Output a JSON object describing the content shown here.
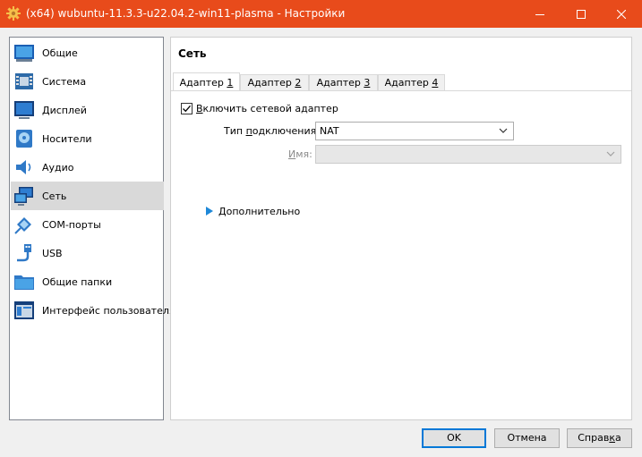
{
  "window": {
    "title": "(x64) wubuntu-11.3.3-u22.04.2-win11-plasma - Настройки",
    "accent": "#e84b1b"
  },
  "sidebar": {
    "items": [
      {
        "label": "Общие",
        "icon": "general-icon"
      },
      {
        "label": "Система",
        "icon": "system-icon"
      },
      {
        "label": "Дисплей",
        "icon": "display-icon"
      },
      {
        "label": "Носители",
        "icon": "storage-icon"
      },
      {
        "label": "Аудио",
        "icon": "audio-icon"
      },
      {
        "label": "Сеть",
        "icon": "network-icon",
        "selected": true
      },
      {
        "label": "COM-порты",
        "icon": "serial-port-icon"
      },
      {
        "label": "USB",
        "icon": "usb-icon"
      },
      {
        "label": "Общие папки",
        "icon": "shared-folder-icon"
      },
      {
        "label": "Интерфейс пользователя",
        "icon": "user-interface-icon"
      }
    ]
  },
  "page": {
    "title": "Сеть",
    "tabs": [
      {
        "prefix": "Адаптер ",
        "num": "1",
        "active": true
      },
      {
        "prefix": "Адаптер ",
        "num": "2"
      },
      {
        "prefix": "Адаптер ",
        "num": "3"
      },
      {
        "prefix": "Адаптер ",
        "num": "4"
      }
    ],
    "enable_checkbox": {
      "label_first": "В",
      "label_rest": "ключить сетевой адаптер",
      "checked": true
    },
    "attachment": {
      "label_a": "Тип ",
      "label_u": "п",
      "label_b": "одключения:",
      "value": "NAT"
    },
    "name": {
      "label_u": "И",
      "label_rest": "мя:",
      "value": ""
    },
    "advanced": {
      "label_u": "Д",
      "label_rest": "ополнительно"
    }
  },
  "buttons": {
    "ok": "OK",
    "cancel": "Отмена",
    "help_a": "Справ",
    "help_u": "к",
    "help_b": "а"
  }
}
